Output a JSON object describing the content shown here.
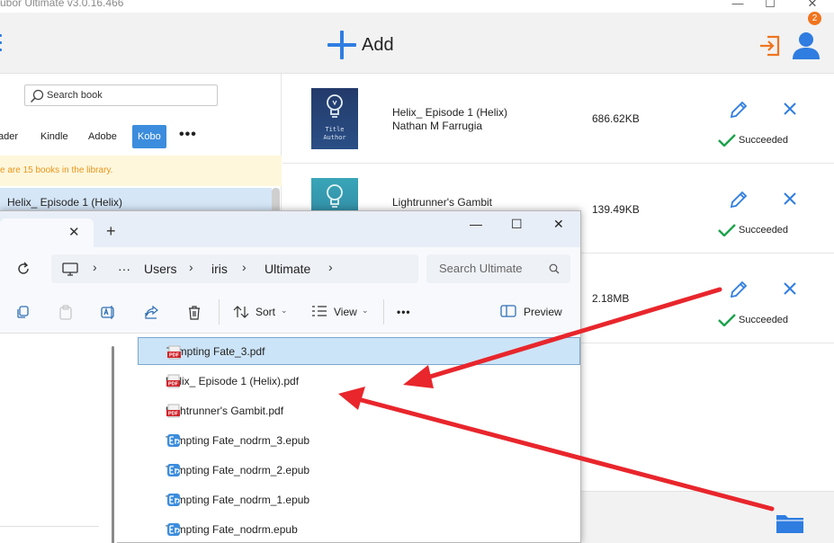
{
  "app": {
    "title": "ubor Ultimate v3.0.16.466",
    "window_controls": {
      "minimize": "—",
      "maximize": "☐",
      "close": "✕"
    },
    "add_label": "Add",
    "notification_count": "2",
    "search_placeholder": "Search book",
    "source_tabs": [
      "ader",
      "Kindle",
      "Adobe",
      "Kobo"
    ],
    "active_source": "Kobo",
    "more_label": "•••",
    "library_notice": "e are 15 books in the library.",
    "selected_book": "Helix_ Episode 1 (Helix)",
    "books": [
      {
        "title": "Helix_ Episode 1 (Helix)",
        "author": "Nathan M Farrugia",
        "size": "686.62KB",
        "status": "Succeeded",
        "cover_top": "Title",
        "cover_bottom": "Author"
      },
      {
        "title": "Lightrunner's Gambit",
        "author": "",
        "size": "139.49KB",
        "status": "Succeeded"
      },
      {
        "title": "",
        "author": "",
        "size": "2.18MB",
        "status": "Succeeded"
      }
    ],
    "colors": {
      "accent": "#2f7de1",
      "badge": "#f0741e",
      "success": "#1aa34a",
      "notice": "#e8951b"
    }
  },
  "explorer": {
    "tab_close": "✕",
    "new_tab": "+",
    "window_controls": {
      "minimize": "—",
      "maximize": "☐",
      "close": "✕"
    },
    "breadcrumb": [
      "···",
      "Users",
      "iris",
      "Ultimate"
    ],
    "search_placeholder": "Search Ultimate",
    "toolbar": {
      "sort": "Sort",
      "view": "View",
      "more": "•••",
      "preview": "Preview"
    },
    "files": [
      {
        "name": "Tempting Fate_3.pdf",
        "type": "pdf",
        "selected": true
      },
      {
        "name": "Helix_ Episode 1 (Helix).pdf",
        "type": "pdf",
        "selected": false
      },
      {
        "name": "Lightrunner's Gambit.pdf",
        "type": "pdf",
        "selected": false
      },
      {
        "name": "Tempting Fate_nodrm_3.epub",
        "type": "epub",
        "selected": false
      },
      {
        "name": "Tempting Fate_nodrm_2.epub",
        "type": "epub",
        "selected": false
      },
      {
        "name": "Tempting Fate_nodrm_1.epub",
        "type": "epub",
        "selected": false
      },
      {
        "name": "Tempting Fate_nodrm.epub",
        "type": "epub",
        "selected": false
      }
    ],
    "pdf_icon_text": "PDF"
  },
  "annotation": {
    "arrow_color": "#e8262c"
  }
}
